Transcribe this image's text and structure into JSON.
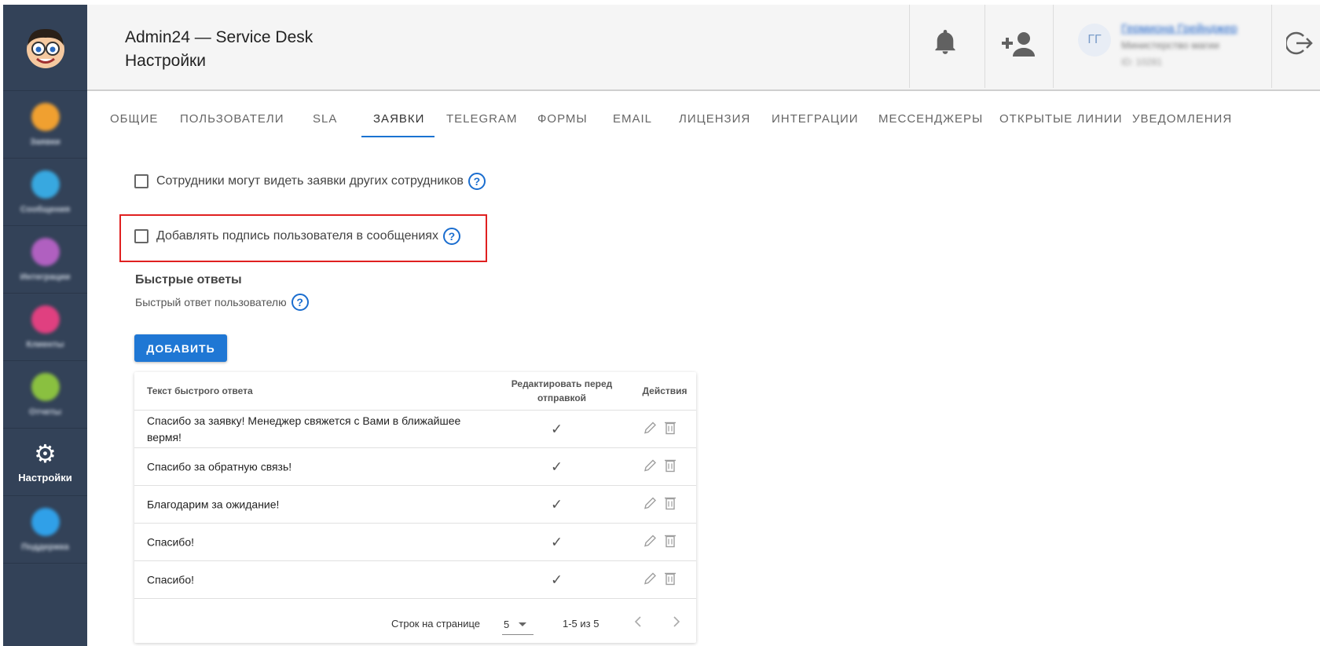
{
  "header": {
    "app_title": "Admin24 — Service Desk",
    "section_title": "Настройки"
  },
  "user": {
    "initials": "ГГ",
    "name": "Гермиона Грейнджер",
    "org": "Министерство магии",
    "id": "ID: 10281"
  },
  "sidebar": {
    "items": [
      {
        "label": "Заявки",
        "color": "#f0a030"
      },
      {
        "label": "Сообщения",
        "color": "#38a8e0"
      },
      {
        "label": "Интеграции",
        "color": "#b060c0"
      },
      {
        "label": "Клиенты",
        "color": "#e04080"
      },
      {
        "label": "Отчеты",
        "color": "#8ac040"
      },
      {
        "label": "Настройки",
        "color": "#ffffff"
      },
      {
        "label": "Поддержка",
        "color": "#30a0e8"
      }
    ]
  },
  "tabs": [
    "Общие",
    "Пользователи",
    "SLA",
    "Заявки",
    "Telegram",
    "Формы",
    "Email",
    "Лицензия",
    "Интеграции",
    "Мессенджеры",
    "Открытые линии",
    "Уведомления"
  ],
  "settings": {
    "checkbox1": "Сотрудники могут видеть заявки других сотрудников",
    "checkbox2": "Добавлять подпись пользователя в сообщениях",
    "help_glyph": "?"
  },
  "quick_answers": {
    "title": "Быстрые ответы",
    "subtitle": "Быстрый ответ пользователю",
    "add_label": "ДОБАВИТЬ",
    "columns": {
      "text": "Текст быстрого ответа",
      "edit": "Редактировать перед отправкой",
      "actions": "Действия"
    },
    "rows": [
      {
        "text": "Спасибо за заявку! Менеджер свяжется с Вами в ближайшее вермя!"
      },
      {
        "text": "Спасибо за обратную связь!"
      },
      {
        "text": "Благодарим за ожидание!"
      },
      {
        "text": "Спасибо!"
      },
      {
        "text": "Спасибо!"
      }
    ],
    "check_glyph": "✓",
    "footer": {
      "rows_per_page_label": "Строк на странице",
      "rows_per_page": "5",
      "range": "1-5 из 5"
    }
  },
  "colors": {
    "sidebar": "#334258",
    "accent": "#1a73d1",
    "highlight": "#e02020"
  }
}
